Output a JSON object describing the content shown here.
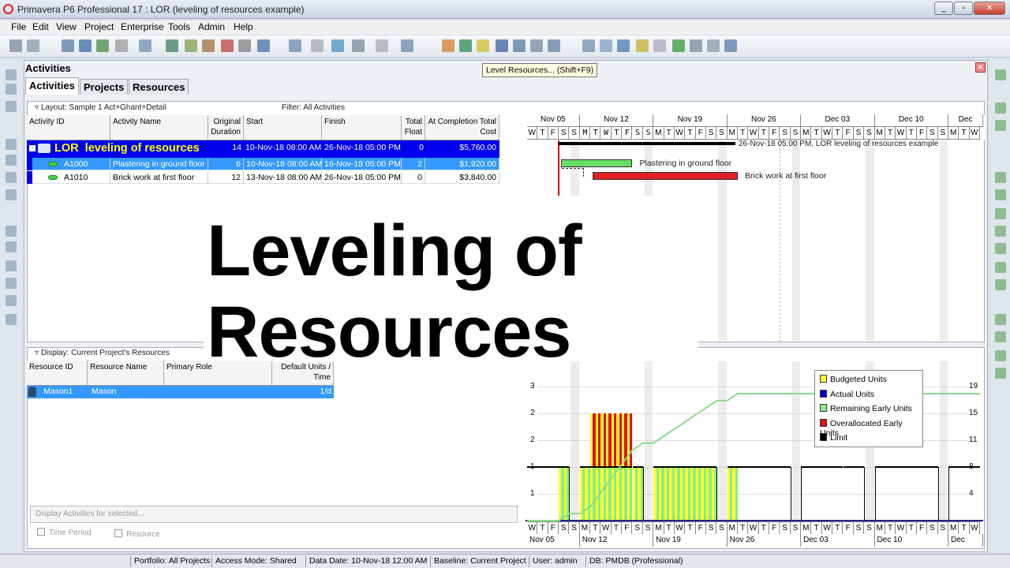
{
  "window": {
    "title": "Primavera P6 Professional 17 : LOR (leveling of resources example)",
    "controls": [
      "_",
      "▫",
      "✕"
    ]
  },
  "menu": [
    "File",
    "Edit",
    "View",
    "Project",
    "Enterprise",
    "Tools",
    "Admin",
    "Help"
  ],
  "tooltip": "Level Resources... (Shift+F9)",
  "panel": {
    "title": "Activities",
    "tabs": [
      "Activities",
      "Projects",
      "Resources"
    ]
  },
  "layout_label": "Layout: Sample 1 Act+Ghant+Detail",
  "filter_label": "Filter: All Activities",
  "activity_columns": [
    "Activity ID",
    "Activity Name",
    "Original Duration",
    "Start",
    "Finish",
    "Total Float",
    "At Completion Total Cost"
  ],
  "project_row": {
    "id": "LOR",
    "name": "leveling of resources",
    "duration": "14",
    "start": "10-Nov-18 08:00 AM",
    "finish": "26-Nov-18 05:00 PM",
    "float": "0",
    "cost": "$5,760.00"
  },
  "activities": [
    {
      "id": "A1000",
      "name": "Plastering in ground floor",
      "duration": "6",
      "start": "10-Nov-18 08:00 AM",
      "finish": "16-Nov-18 05:00 PM",
      "float": "2",
      "cost": "$1,920.00"
    },
    {
      "id": "A1010",
      "name": "Brick work at first floor",
      "duration": "12",
      "start": "13-Nov-18 08:00 AM",
      "finish": "26-Nov-18 05:00 PM",
      "float": "0",
      "cost": "$3,840.00"
    }
  ],
  "gantt": {
    "weeks": [
      "Nov 05",
      "Nov 12",
      "Nov 19",
      "Nov 26",
      "Dec 03",
      "Dec 10",
      "Dec"
    ],
    "day_letters": "MTWTFSS",
    "first_day": "2018-11-07",
    "data_date": "2018-11-10",
    "summary_label": "26-Nov-18 05:00 PM, LOR  leveling of resources example",
    "bars": [
      {
        "label": "Plastering in ground floor",
        "start": "2018-11-10",
        "end": "2018-11-16",
        "color": "#66e066"
      },
      {
        "label": "Brick work at first floor",
        "start": "2018-11-13",
        "end": "2018-11-26",
        "color": "#e02020"
      }
    ]
  },
  "overlay": {
    "line1": "Leveling of",
    "line2": "Resources"
  },
  "resource_display_label": "Display: Current Project's Resources",
  "resource_columns": [
    "Resource ID",
    "Resource Name",
    "Primary Role",
    "Default Units / Time"
  ],
  "resources": [
    {
      "id": "Mason1",
      "name": "Mason",
      "role": "",
      "units": "1/d"
    }
  ],
  "display_activities_btn": "Display Activities for selected...",
  "checkboxes": [
    "Time Period",
    "Resource"
  ],
  "resource_chart": {
    "left_ticks": [
      "3",
      "2",
      "2",
      "1",
      "1"
    ],
    "right_ticks": [
      "19",
      "15",
      "11",
      "8",
      "4"
    ],
    "legend": [
      {
        "label": "Budgeted Units",
        "color": "#ffff33"
      },
      {
        "label": "Actual Units",
        "color": "#0000cc"
      },
      {
        "label": "Remaining Early Units",
        "color": "#88ee88"
      },
      {
        "label": "Overallocated Early Units",
        "color": "#e01010"
      },
      {
        "label": "Limit",
        "color": "#000000"
      }
    ],
    "daily_units": {
      "2018-11-10": 1,
      "2018-11-12": 1,
      "2018-11-13": 2,
      "2018-11-14": 2,
      "2018-11-15": 2,
      "2018-11-16": 2,
      "2018-11-17": 1,
      "2018-11-19": 1,
      "2018-11-20": 1,
      "2018-11-21": 1,
      "2018-11-22": 1,
      "2018-11-23": 1,
      "2018-11-24": 1,
      "2018-11-26": 1
    },
    "limit": 1
  },
  "status": [
    "Portfolio: All Projects",
    "Access Mode: Shared",
    "Data Date: 10-Nov-18 12:00 AM",
    "Baseline: Current Project",
    "User: admin",
    "DB: PMDB (Professional)"
  ]
}
